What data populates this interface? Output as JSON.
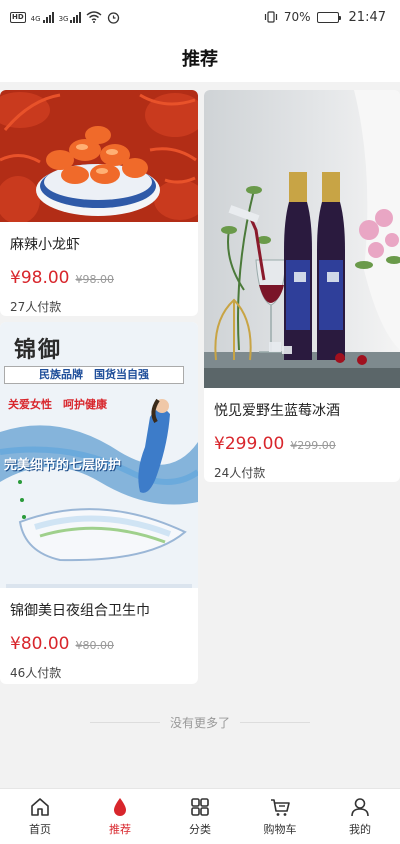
{
  "status_bar": {
    "hd_badge": "HD",
    "net1": "4G",
    "net2": "3G",
    "battery_text": "70%",
    "battery_level": 0.7,
    "time": "21:47"
  },
  "header": {
    "title": "推荐"
  },
  "products": [
    {
      "name": "麻辣小龙虾",
      "price": "¥98.00",
      "original_price": "¥98.00",
      "paid_count": "27人付款",
      "image_icon": "crayfish-image"
    },
    {
      "name": "悦见爱野生蓝莓冰酒",
      "price": "¥299.00",
      "original_price": "¥299.00",
      "paid_count": "24人付款",
      "image_icon": "wine-image"
    },
    {
      "name": "锦御美日夜组合卫生巾",
      "price": "¥80.00",
      "original_price": "¥80.00",
      "paid_count": "46人付款",
      "image_icon": "sanitary-pad-image",
      "image_texts": {
        "brand": "锦御",
        "banner": "民族品牌　国货当自强",
        "slogan": "关爱女性　呵护健康",
        "headline": "完美细节的七层防护"
      }
    }
  ],
  "list_end_text": "没有更多了",
  "tabbar": {
    "items": [
      {
        "label": "首页",
        "icon": "home-icon",
        "active": false
      },
      {
        "label": "推荐",
        "icon": "drop-icon",
        "active": true
      },
      {
        "label": "分类",
        "icon": "grid-icon",
        "active": false
      },
      {
        "label": "购物车",
        "icon": "cart-icon",
        "active": false
      },
      {
        "label": "我的",
        "icon": "person-icon",
        "active": false
      }
    ],
    "accent_color": "#d8262c"
  }
}
